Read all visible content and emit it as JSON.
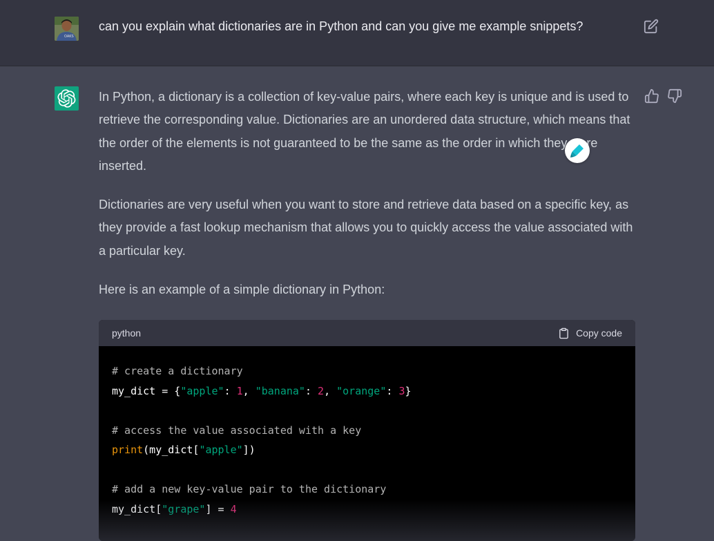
{
  "user_message": {
    "text": "can you explain what dictionaries are in Python and can you give me example snippets?",
    "avatar_icon": "user-photo",
    "edit_icon": "edit-icon"
  },
  "assistant_message": {
    "logo_icon": "openai-logo",
    "paragraphs": [
      "In Python, a dictionary is a collection of key-value pairs, where each key is unique and is used to retrieve the corresponding value. Dictionaries are an unordered data structure, which means that the order of the elements is not guaranteed to be the same as the order in which they were inserted.",
      "Dictionaries are very useful when you want to store and retrieve data based on a specific key, as they provide a fast lookup mechanism that allows you to quickly access the value associated with a particular key.",
      "Here is an example of a simple dictionary in Python:"
    ],
    "feedback": {
      "up_icon": "thumbs-up-icon",
      "down_icon": "thumbs-down-icon"
    }
  },
  "code_block": {
    "language": "python",
    "copy_label": "Copy code",
    "copy_icon": "clipboard-icon",
    "lines": [
      {
        "parts": [
          {
            "t": "# create a dictionary",
            "k": "c"
          }
        ]
      },
      {
        "parts": [
          {
            "t": "my_dict = {",
            "k": "p"
          },
          {
            "t": "\"apple\"",
            "k": "s"
          },
          {
            "t": ": ",
            "k": "p"
          },
          {
            "t": "1",
            "k": "n"
          },
          {
            "t": ", ",
            "k": "p"
          },
          {
            "t": "\"banana\"",
            "k": "s"
          },
          {
            "t": ": ",
            "k": "p"
          },
          {
            "t": "2",
            "k": "n"
          },
          {
            "t": ", ",
            "k": "p"
          },
          {
            "t": "\"orange\"",
            "k": "s"
          },
          {
            "t": ": ",
            "k": "p"
          },
          {
            "t": "3",
            "k": "n"
          },
          {
            "t": "}",
            "k": "p"
          }
        ]
      },
      {
        "parts": []
      },
      {
        "parts": [
          {
            "t": "# access the value associated with a key",
            "k": "c"
          }
        ]
      },
      {
        "parts": [
          {
            "t": "print",
            "k": "f"
          },
          {
            "t": "(my_dict[",
            "k": "p"
          },
          {
            "t": "\"apple\"",
            "k": "s"
          },
          {
            "t": "])",
            "k": "p"
          }
        ]
      },
      {
        "parts": []
      },
      {
        "parts": [
          {
            "t": "# add a new key-value pair to the dictionary",
            "k": "c"
          }
        ]
      },
      {
        "parts": [
          {
            "t": "my_dict[",
            "k": "p"
          },
          {
            "t": "\"grape\"",
            "k": "s"
          },
          {
            "t": "] = ",
            "k": "p"
          },
          {
            "t": "4",
            "k": "n"
          }
        ]
      }
    ]
  },
  "colors": {
    "page_bg": "#444654",
    "user_row_bg": "#343541",
    "accent": "#10a37f",
    "code_string": "#00a67d",
    "code_number": "#df3079",
    "code_function": "#e9950c",
    "code_comment": "#b4b4b4"
  },
  "overlay": {
    "icon": "highlighter-pen-icon"
  }
}
